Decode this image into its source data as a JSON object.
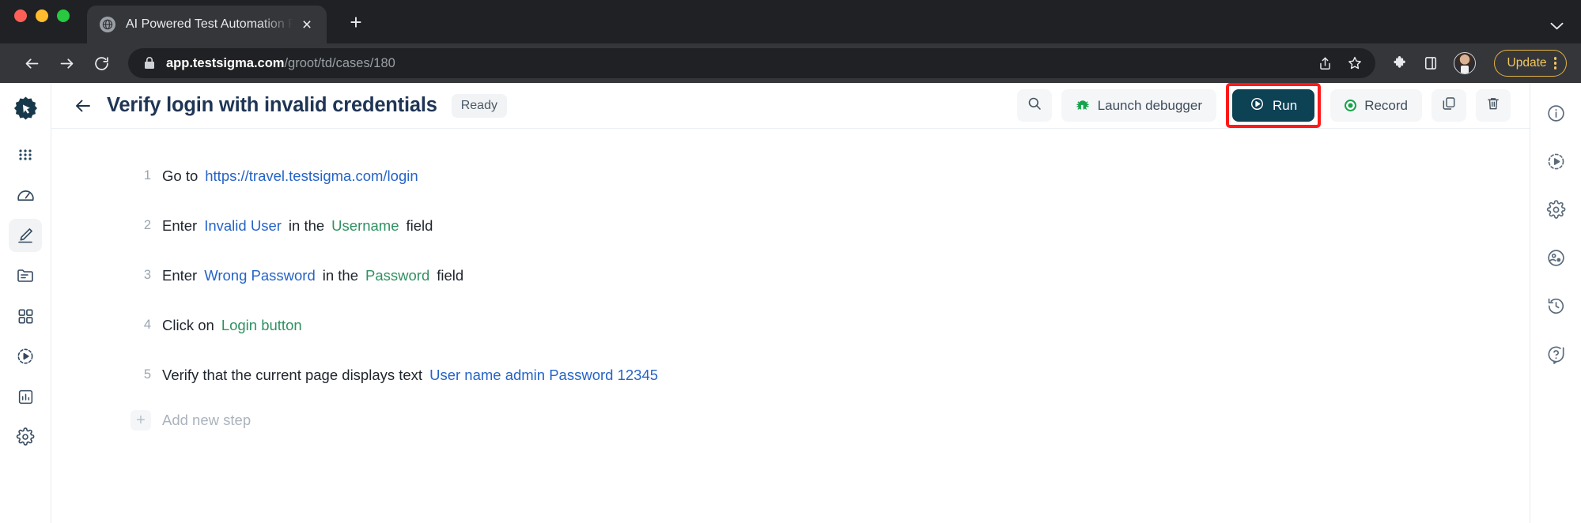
{
  "browser": {
    "tab": {
      "title": "AI Powered Test Automation Pla",
      "favicon": "globe-icon",
      "close": "×"
    },
    "newtab_label": "+",
    "tabstrip_menu": "chevron-down-icon",
    "toolbar": {
      "back": "back-arrow-icon",
      "forward": "forward-arrow-icon",
      "reload": "reload-icon",
      "lock": "lock-icon",
      "url_host": "app.testsigma.com",
      "url_path": "/groot/td/cases/180",
      "share": "share-icon",
      "bookmark": "star-icon",
      "extensions": "puzzle-icon",
      "sidepanel": "side-panel-icon",
      "profile": "avatar",
      "update_label": "Update",
      "menu": "kebab-menu-icon"
    }
  },
  "app": {
    "logo": "testsigma-logo",
    "left_nav": [
      {
        "name": "apps-grid",
        "icon": "grid-dots-icon",
        "active": false
      },
      {
        "name": "dashboard",
        "icon": "speedometer-icon",
        "active": false
      },
      {
        "name": "test-authoring",
        "icon": "pencil-icon",
        "active": true
      },
      {
        "name": "test-plans",
        "icon": "folder-icon",
        "active": false
      },
      {
        "name": "test-suites",
        "icon": "squares-icon",
        "active": false
      },
      {
        "name": "runs",
        "icon": "play-circle-dashed-icon",
        "active": false
      },
      {
        "name": "reports",
        "icon": "bar-chart-icon",
        "active": false
      },
      {
        "name": "settings",
        "icon": "gear-icon",
        "active": false
      }
    ],
    "header": {
      "back": "back-arrow-icon",
      "title": "Verify login with invalid credentials",
      "status": "Ready",
      "search_icon": "search-icon",
      "launch_debugger": "Launch debugger",
      "debugger_icon": "bug-icon",
      "run": "Run",
      "run_icon": "play-circle-icon",
      "record": "Record",
      "record_icon": "record-dot-icon",
      "copy_icon": "copy-icon",
      "delete_icon": "trash-icon",
      "run_highlight_color": "#ff1a1a",
      "run_button_color": "#0d4154",
      "accent_green": "#16a34a"
    },
    "steps": [
      {
        "num": "1",
        "tokens": [
          {
            "text": "Go to",
            "kind": "plain"
          },
          {
            "text": "https://travel.testsigma.com/login",
            "kind": "data"
          }
        ]
      },
      {
        "num": "2",
        "tokens": [
          {
            "text": "Enter",
            "kind": "plain"
          },
          {
            "text": "Invalid User",
            "kind": "data"
          },
          {
            "text": "in the",
            "kind": "plain"
          },
          {
            "text": "Username",
            "kind": "element"
          },
          {
            "text": "field",
            "kind": "plain"
          }
        ]
      },
      {
        "num": "3",
        "tokens": [
          {
            "text": "Enter",
            "kind": "plain"
          },
          {
            "text": "Wrong Password",
            "kind": "data"
          },
          {
            "text": "in the",
            "kind": "plain"
          },
          {
            "text": "Password",
            "kind": "element"
          },
          {
            "text": "field",
            "kind": "plain"
          }
        ]
      },
      {
        "num": "4",
        "tokens": [
          {
            "text": "Click on",
            "kind": "plain"
          },
          {
            "text": "Login button",
            "kind": "element"
          }
        ]
      },
      {
        "num": "5",
        "tokens": [
          {
            "text": "Verify that the current page displays text",
            "kind": "plain"
          },
          {
            "text": "User name admin Password 12345",
            "kind": "data"
          }
        ]
      }
    ],
    "add_step": {
      "plus": "+",
      "label": "Add new step"
    },
    "right_nav": [
      {
        "name": "details",
        "icon": "info-circle-icon"
      },
      {
        "name": "run-results",
        "icon": "play-circle-dashed-icon"
      },
      {
        "name": "settings",
        "icon": "gear-icon"
      },
      {
        "name": "test-data",
        "icon": "data-circle-icon"
      },
      {
        "name": "history",
        "icon": "history-clock-icon"
      },
      {
        "name": "help",
        "icon": "help-circle-icon"
      }
    ]
  }
}
